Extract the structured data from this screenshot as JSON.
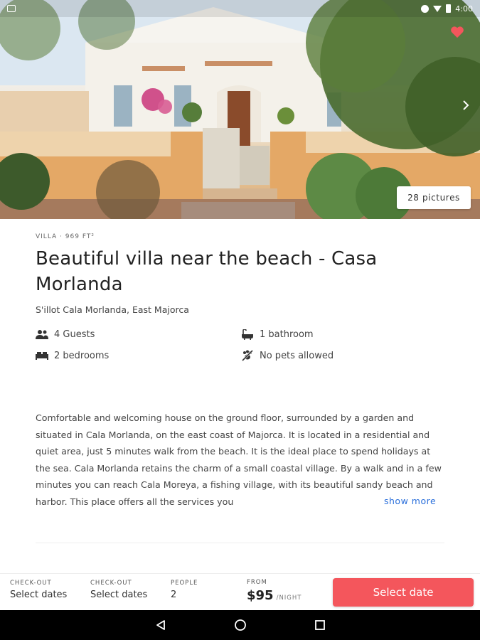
{
  "status_bar": {
    "time": "4:00"
  },
  "hero": {
    "pictures_label": "28 pictures",
    "favorite_icon": "heart-icon",
    "next_icon": "chevron-right-icon"
  },
  "listing": {
    "category": "VILLA · 969 FT²",
    "title": "Beautiful villa near the beach - Casa Morlanda",
    "location": "S'illot Cala Morlanda, East Majorca",
    "amenities": [
      {
        "icon": "guests-icon",
        "label": "4 Guests"
      },
      {
        "icon": "bath-icon",
        "label": "1 bathroom"
      },
      {
        "icon": "bed-icon",
        "label": "2 bedrooms"
      },
      {
        "icon": "no-pets-icon",
        "label": "No pets allowed"
      }
    ],
    "description": "Comfortable and welcoming house on the ground floor, surrounded by a garden and situated in Cala Morlanda, on the east coast of Majorca. It is located in a residential and quiet area, just 5 minutes walk from the beach. It is the ideal place to spend holidays at the sea. Cala Morlanda retains the charm of a small coastal village. By a walk and in a few minutes you can reach Cala Moreya, a fishing village, with its beautiful sandy beach and harbor. This place offers all the services you",
    "show_more": "show more"
  },
  "booking": {
    "checkin_label": "CHECK-OUT",
    "checkin_value": "Select dates",
    "checkout_label": "CHECK-OUT",
    "checkout_value": "Select dates",
    "people_label": "PEOPLE",
    "people_value": "2",
    "price_from": "FROM",
    "price": "$95",
    "price_unit": "/NIGHT",
    "select_button": "Select date"
  },
  "colors": {
    "accent": "#f4565c",
    "link": "#2a6fdb",
    "heart": "#f4565c"
  }
}
